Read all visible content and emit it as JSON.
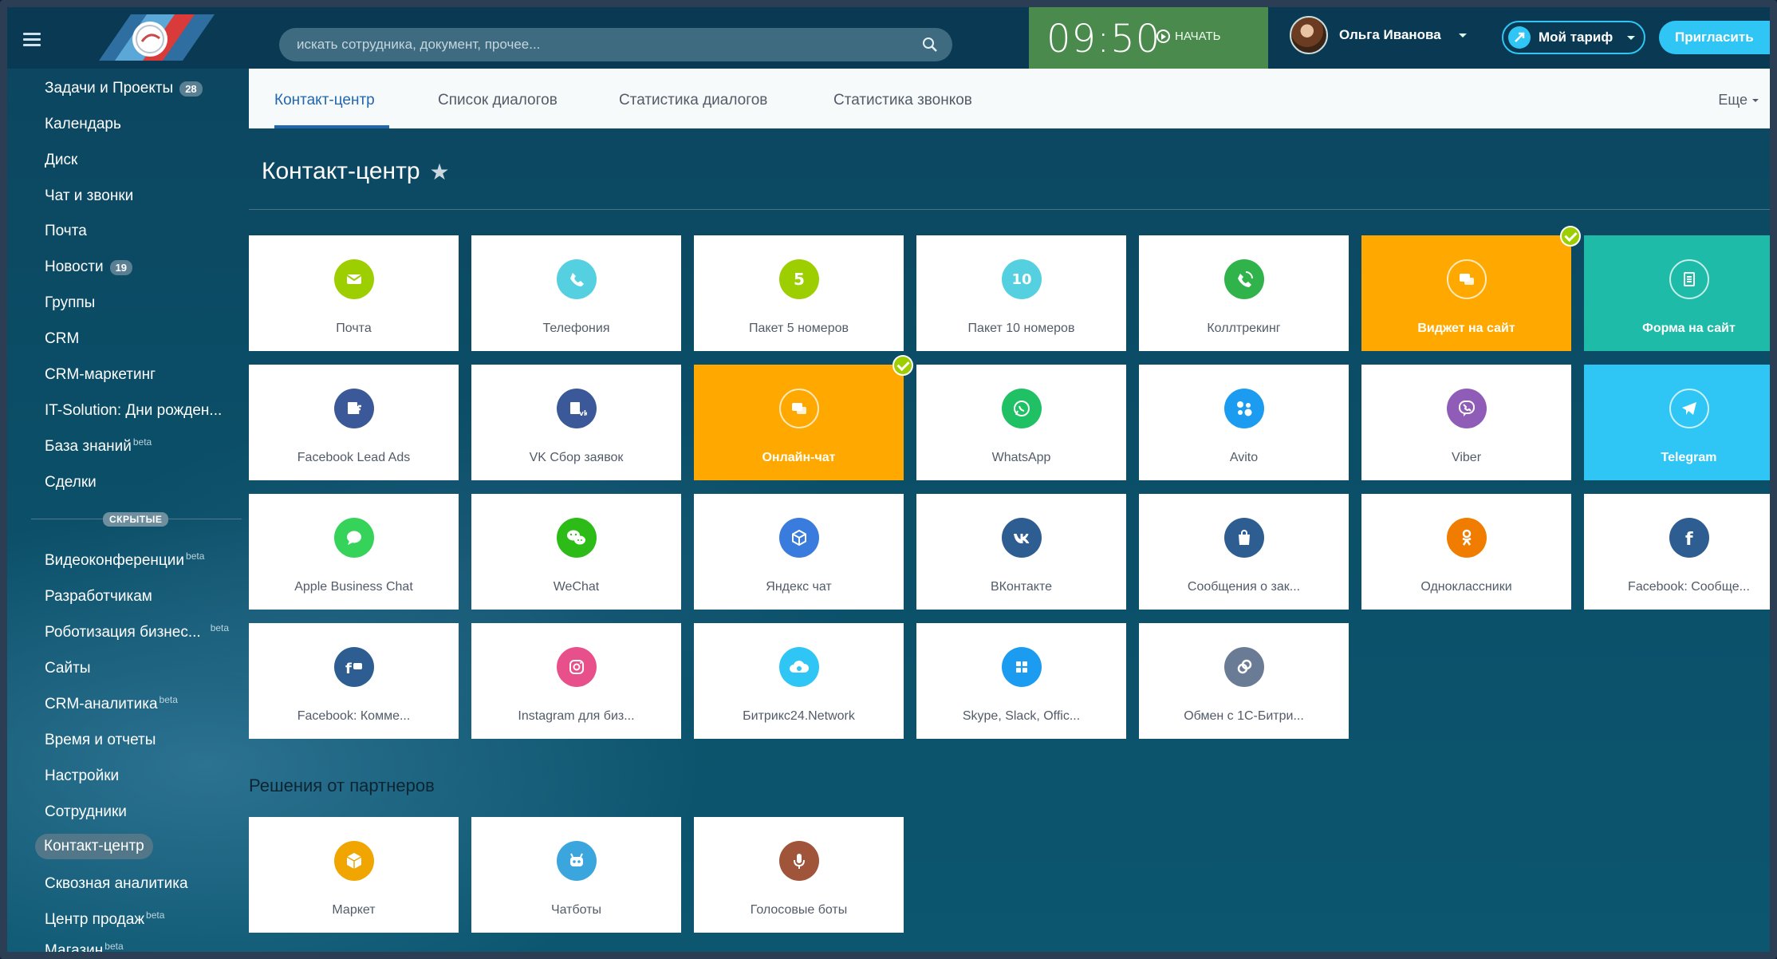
{
  "search": {
    "placeholder": "искать сотрудника, документ, прочее..."
  },
  "clock": {
    "time": "09:50",
    "start_label": "НАЧАТЬ"
  },
  "user": {
    "name": "Ольга Иванова"
  },
  "tariff": {
    "label": "Мой тариф"
  },
  "invite": {
    "label": "Пригласить"
  },
  "sidebar": {
    "items": [
      {
        "label": "Задачи и Проекты",
        "count": "28"
      },
      {
        "label": "Календарь"
      },
      {
        "label": "Диск"
      },
      {
        "label": "Чат и звонки"
      },
      {
        "label": "Почта"
      },
      {
        "label": "Новости",
        "count": "19"
      },
      {
        "label": "Группы"
      },
      {
        "label": "CRM"
      },
      {
        "label": "CRM-маркетинг"
      },
      {
        "label": "IT-Solution: Дни рожден..."
      },
      {
        "label": "База знаний",
        "sup": "beta"
      },
      {
        "label": "Сделки"
      }
    ],
    "hidden_label": "СКРЫТЫЕ",
    "hidden_items": [
      {
        "label": "Видеоконференции",
        "sup": "beta"
      },
      {
        "label": "Разработчикам"
      },
      {
        "label": "Роботизация бизнес...",
        "sup": "beta"
      },
      {
        "label": "Сайты"
      },
      {
        "label": "CRM-аналитика",
        "sup": "beta"
      },
      {
        "label": "Время и отчеты"
      },
      {
        "label": "Настройки"
      },
      {
        "label": "Сотрудники"
      },
      {
        "label": "Контакт-центр",
        "active": true
      },
      {
        "label": "Сквозная аналитика"
      },
      {
        "label": "Центр продаж",
        "sup": "beta"
      },
      {
        "label": "Магазин",
        "sup": "beta"
      }
    ]
  },
  "tabs": [
    {
      "label": "Контакт-центр",
      "active": true
    },
    {
      "label": "Список диалогов"
    },
    {
      "label": "Статистика диалогов"
    },
    {
      "label": "Статистика звонков"
    }
  ],
  "more_label": "Еще",
  "page_title": "Контакт-центр",
  "tiles": [
    {
      "label": "Почта",
      "icon": "mail-icon",
      "color": "#9dcf00"
    },
    {
      "label": "Телефония",
      "icon": "phone-icon",
      "color": "#55d0e0"
    },
    {
      "label": "Пакет 5 номеров",
      "icon": "pack5-icon",
      "color": "#9dcf00",
      "glyph": "5"
    },
    {
      "label": "Пакет 10 номеров",
      "icon": "pack10-icon",
      "color": "#55d0e0",
      "glyph": "10"
    },
    {
      "label": "Коллтрекинг",
      "icon": "calltracking-icon",
      "color": "#2fb34a"
    },
    {
      "label": "Виджет на сайт",
      "icon": "widget-icon",
      "color": "#ffa900",
      "style": "orange",
      "checked": true
    },
    {
      "label": "Форма на сайт",
      "icon": "form-icon",
      "color": "#1fbba9",
      "style": "teal"
    },
    {
      "label": "Facebook Lead Ads",
      "icon": "facebook-lead-ads-icon",
      "color": "#3b5998"
    },
    {
      "label": "VK Сбор заявок",
      "icon": "vk-leads-icon",
      "color": "#3b5998"
    },
    {
      "label": "Онлайн-чат",
      "icon": "online-chat-icon",
      "color": "#ffa900",
      "style": "orange",
      "checked": true
    },
    {
      "label": "WhatsApp",
      "icon": "whatsapp-icon",
      "color": "#20c065"
    },
    {
      "label": "Avito",
      "icon": "avito-icon",
      "color": "#1b9cf0"
    },
    {
      "label": "Viber",
      "icon": "viber-icon",
      "color": "#8f5db7"
    },
    {
      "label": "Telegram",
      "icon": "telegram-icon",
      "color": "#2fc6f6",
      "style": "sky"
    },
    {
      "label": "Apple Business Chat",
      "icon": "apple-business-chat-icon",
      "color": "#36d35a"
    },
    {
      "label": "WeChat",
      "icon": "wechat-icon",
      "color": "#2dbb17"
    },
    {
      "label": "Яндекс чат",
      "icon": "yandex-chat-icon",
      "color": "#3a7cdd"
    },
    {
      "label": "ВКонтакте",
      "icon": "vk-icon",
      "color": "#2d5d91"
    },
    {
      "label": "Сообщения о зак...",
      "icon": "vk-orders-icon",
      "color": "#2d5d91"
    },
    {
      "label": "Одноклассники",
      "icon": "odnoklassniki-icon",
      "color": "#f07d00"
    },
    {
      "label": "Facebook: Сообще...",
      "icon": "facebook-icon",
      "color": "#2d5d91"
    },
    {
      "label": "Facebook: Комме...",
      "icon": "facebook-comments-icon",
      "color": "#2d5d91"
    },
    {
      "label": "Instagram для биз...",
      "icon": "instagram-icon",
      "color": "#e8508b"
    },
    {
      "label": "Битрикс24.Network",
      "icon": "cloud-icon",
      "color": "#2fc6f6"
    },
    {
      "label": "Skype, Slack, Offic...",
      "icon": "apps-icon",
      "color": "#1b9cf0"
    },
    {
      "label": "Обмен с 1С-Битри...",
      "icon": "exchange-1c-icon",
      "color": "#6a7c95"
    }
  ],
  "partners_title": "Решения от партнеров",
  "partner_tiles": [
    {
      "label": "Маркет",
      "icon": "market-icon",
      "color": "#f0a500"
    },
    {
      "label": "Чатботы",
      "icon": "chatbot-icon",
      "color": "#3ba6dd"
    },
    {
      "label": "Голосовые боты",
      "icon": "voice-bot-icon",
      "color": "#a0543a"
    }
  ]
}
